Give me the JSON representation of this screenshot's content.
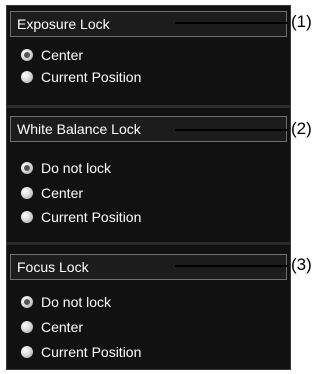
{
  "sections": [
    {
      "title": "Exposure Lock",
      "callout": "(1)",
      "options": [
        {
          "label": "Center",
          "selected": true
        },
        {
          "label": "Current Position",
          "selected": false
        }
      ]
    },
    {
      "title": "White Balance Lock",
      "callout": "(2)",
      "options": [
        {
          "label": "Do not lock",
          "selected": true
        },
        {
          "label": "Center",
          "selected": false
        },
        {
          "label": "Current Position",
          "selected": false
        }
      ]
    },
    {
      "title": "Focus Lock",
      "callout": "(3)",
      "options": [
        {
          "label": "Do not lock",
          "selected": true
        },
        {
          "label": "Center",
          "selected": false
        },
        {
          "label": "Current Position",
          "selected": false
        }
      ]
    }
  ]
}
